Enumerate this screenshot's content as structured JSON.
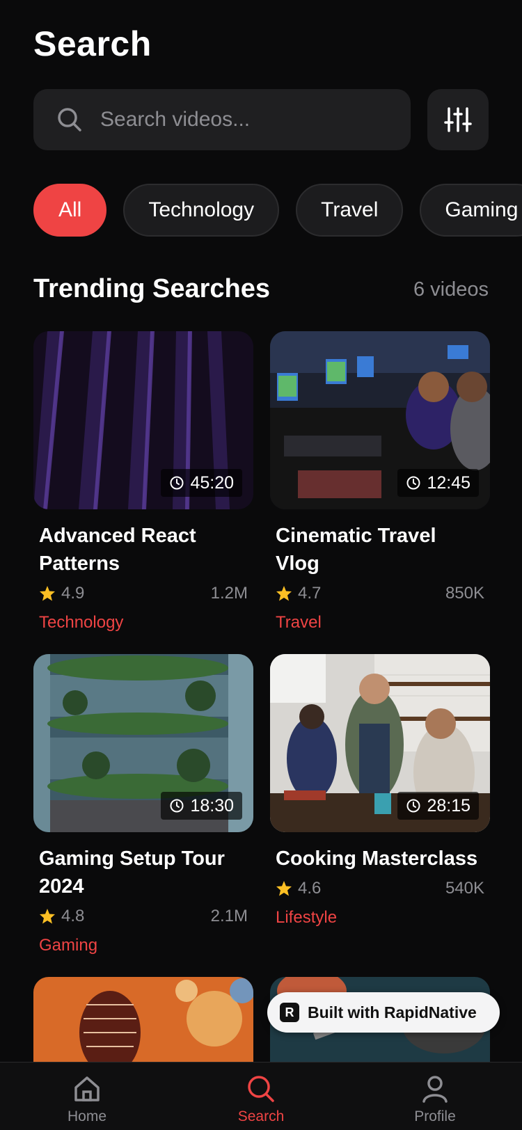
{
  "header": {
    "title": "Search"
  },
  "search": {
    "placeholder": "Search videos..."
  },
  "categories": [
    "All",
    "Technology",
    "Travel",
    "Gaming"
  ],
  "section": {
    "title": "Trending Searches",
    "count": "6 videos"
  },
  "videos": [
    {
      "title": "Advanced React Patterns",
      "duration": "45:20",
      "rating": "4.9",
      "views": "1.2M",
      "category": "Technology"
    },
    {
      "title": "Cinematic Travel Vlog",
      "duration": "12:45",
      "rating": "4.7",
      "views": "850K",
      "category": "Travel"
    },
    {
      "title": "Gaming Setup Tour 2024",
      "duration": "18:30",
      "rating": "4.8",
      "views": "2.1M",
      "category": "Gaming"
    },
    {
      "title": "Cooking Masterclass",
      "duration": "28:15",
      "rating": "4.6",
      "views": "540K",
      "category": "Lifestyle"
    }
  ],
  "badge": {
    "label": "Built with RapidNative"
  },
  "tabbar": {
    "home": "Home",
    "search": "Search",
    "profile": "Profile"
  },
  "colors": {
    "accent": "#ef4444",
    "background": "#0a0a0b",
    "star": "#fbbf24"
  }
}
